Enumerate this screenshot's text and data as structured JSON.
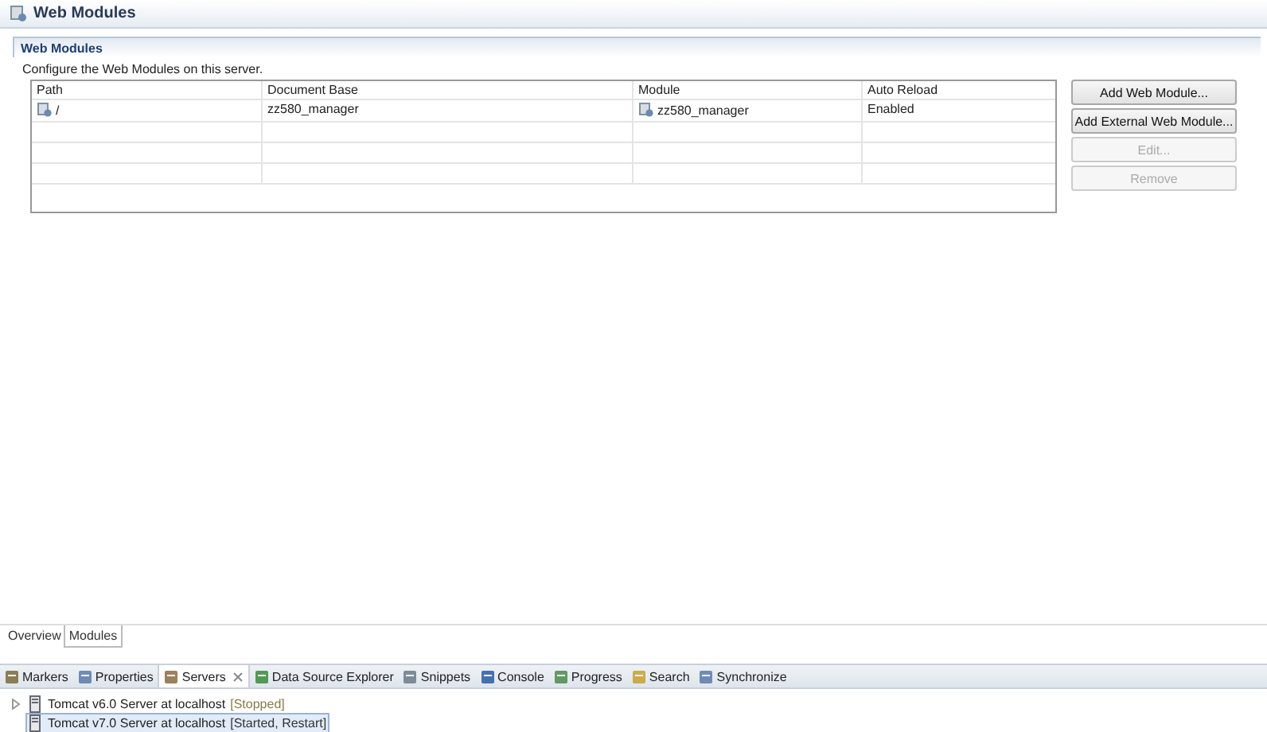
{
  "editor": {
    "title": "Web Modules"
  },
  "section": {
    "title": "Web Modules",
    "description": "Configure the Web Modules on this server."
  },
  "table": {
    "columns": [
      "Path",
      "Document Base",
      "Module",
      "Auto Reload"
    ],
    "rows": [
      {
        "path": "/",
        "document_base": "zz580_manager",
        "module": "zz580_manager",
        "auto_reload": "Enabled"
      }
    ]
  },
  "buttons": [
    {
      "label": "Add Web Module...",
      "disabled": false
    },
    {
      "label": "Add External Web Module...",
      "disabled": false
    },
    {
      "label": "Edit...",
      "disabled": true
    },
    {
      "label": "Remove",
      "disabled": true
    }
  ],
  "editor_tabs": [
    {
      "label": "Overview",
      "selected": false
    },
    {
      "label": "Modules",
      "selected": true
    }
  ],
  "view_tabs": [
    {
      "label": "Markers",
      "selected": false
    },
    {
      "label": "Properties",
      "selected": false
    },
    {
      "label": "Servers",
      "selected": true
    },
    {
      "label": "Data Source Explorer",
      "selected": false
    },
    {
      "label": "Snippets",
      "selected": false
    },
    {
      "label": "Console",
      "selected": false
    },
    {
      "label": "Progress",
      "selected": false
    },
    {
      "label": "Search",
      "selected": false
    },
    {
      "label": "Synchronize",
      "selected": false
    }
  ],
  "servers": [
    {
      "name": "Tomcat v6.0 Server at localhost",
      "status": "[Stopped]",
      "expandable": true,
      "selected": false
    },
    {
      "name": "Tomcat v7.0 Server at localhost",
      "status": "[Started, Restart]",
      "expandable": false,
      "selected": true
    }
  ]
}
